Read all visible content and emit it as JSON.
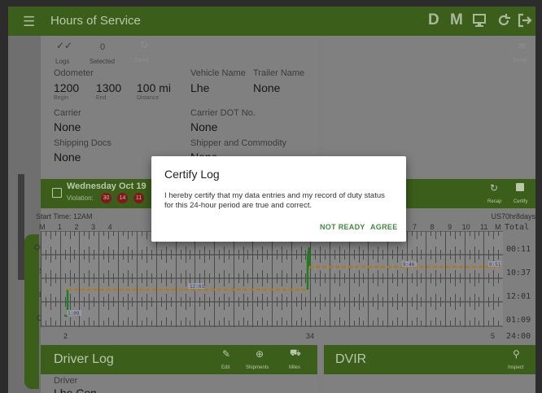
{
  "appbar": {
    "title": "Hours of Service",
    "menu_icon": "hamburger-icon",
    "actions": [
      {
        "name": "driving-mode-button",
        "label": "D"
      },
      {
        "name": "messages-button",
        "label": "M"
      },
      {
        "name": "inspection-icon",
        "label": "🖥"
      },
      {
        "name": "refresh-icon",
        "label": "↻"
      },
      {
        "name": "logout-icon",
        "label": "⇥"
      }
    ]
  },
  "toolbar": {
    "logs_label": "Logs",
    "selected_count": "0",
    "selected_label": "Selected",
    "send_label": "Send",
    "email_label": "Email"
  },
  "summary": {
    "odometer_label": "Odometer",
    "odo_begin": "1200",
    "odo_begin_sub": "Begin",
    "odo_end": "1300",
    "odo_end_sub": "End",
    "odo_distance": "100 mi",
    "odo_distance_sub": "Distance",
    "vehicle_name_label": "Vehicle Name",
    "vehicle_name": "Lhe",
    "trailer_name_label": "Trailer Name",
    "trailer_name": "None",
    "carrier_label": "Carrier",
    "carrier": "None",
    "carrier_dot_label": "Carrier DOT No.",
    "carrier_dot": "None",
    "shipping_docs_label": "Shipping Docs",
    "shipping_docs": "None",
    "shipper_label": "Shipper and Commodity",
    "shipper": "None"
  },
  "day_header": {
    "date": "Wednesday Oct 19",
    "violation_label": "Violation:",
    "violations": [
      "30",
      "14",
      "11"
    ],
    "recap_label": "Recap",
    "certify_label": "Certify"
  },
  "graph": {
    "start_time": "Start Time: 12AM",
    "ruleset": "US70hr8days",
    "hours_left": [
      "M",
      "1",
      "2",
      "3",
      "4"
    ],
    "hours_right": [
      "7",
      "8",
      "9",
      "10",
      "11",
      "M"
    ],
    "total_label": "Total",
    "rows": [
      {
        "name": "OFF",
        "total": "00:11"
      },
      {
        "name": "SB",
        "total": "10:37"
      },
      {
        "name": "D",
        "total": "12:01"
      },
      {
        "name": "ON",
        "total": "01:09"
      }
    ],
    "grand_total": "24:00",
    "markers": {
      "d_duration": "12:01",
      "on_duration": "1:09",
      "sb_a": "9:46",
      "sb_b": "0:51"
    },
    "bottom_labels": [
      "2",
      "34",
      "5"
    ]
  },
  "driver_log": {
    "title": "Driver Log",
    "edit_label": "Edit",
    "shipments_label": "Shipments",
    "miles_label": "Miles",
    "driver_label": "Driver",
    "driver_value": "Lhe Con"
  },
  "dvir": {
    "title": "DVIR",
    "inspect_label": "Inspect"
  },
  "dialog": {
    "title": "Certify Log",
    "message": "I hereby certify that my data entries and my record of duty status for this 24-hour period are true and correct.",
    "cancel_label": "NOT READY",
    "ok_label": "AGREE"
  },
  "colors": {
    "header_green": "#3b5f1b",
    "violation_red": "#a1151b",
    "button_green": "#3e8a3e",
    "driving_line": "#1b7f1b",
    "sb_line": "#b07a18"
  }
}
